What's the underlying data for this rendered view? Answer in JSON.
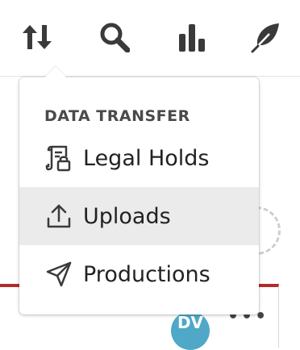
{
  "toolbar": {
    "buttons": [
      {
        "icon": "transfer-arrows-icon"
      },
      {
        "icon": "search-icon"
      },
      {
        "icon": "bar-chart-icon"
      },
      {
        "icon": "feather-icon"
      }
    ]
  },
  "dropdown": {
    "section_title": "DATA TRANSFER",
    "items": [
      {
        "label": "Legal Holds",
        "icon": "legal-hold-icon"
      },
      {
        "label": "Uploads",
        "icon": "upload-icon",
        "highlighted": true
      },
      {
        "label": "Productions",
        "icon": "send-icon"
      }
    ]
  },
  "background": {
    "avatar_initials": "DV",
    "more_label": "•••"
  },
  "colors": {
    "accent_red": "#b52b2b",
    "avatar": "#4fa8c7",
    "hover_bg": "#ebebeb",
    "icon_dark": "#3a3a3a"
  }
}
